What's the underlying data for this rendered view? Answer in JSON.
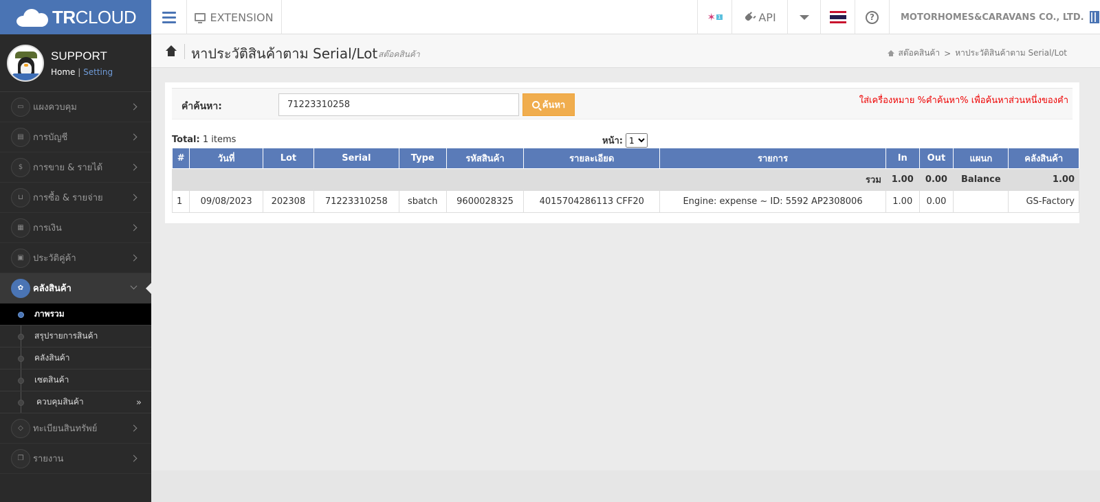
{
  "brand": {
    "bold": "TR",
    "light": "CLOUD"
  },
  "topbar": {
    "extension_label": "EXTENSION",
    "notification_count": "1",
    "api_label": "API",
    "company_name": "MOTORHOMES&CARAVANS CO., LTD.",
    "help_glyph": "?"
  },
  "profile": {
    "name": "SUPPORT",
    "home_link": "Home",
    "separator": "|",
    "setting_link": "Setting"
  },
  "sidebar": {
    "items": [
      {
        "label": "แผงควบคุม",
        "icon": "monitor-icon"
      },
      {
        "label": "การบัญชี",
        "icon": "book-icon"
      },
      {
        "label": "การขาย & รายได้",
        "icon": "dollar-icon"
      },
      {
        "label": "การซื้อ & รายจ่าย",
        "icon": "cart-icon"
      },
      {
        "label": "การเงิน",
        "icon": "calendar-icon"
      },
      {
        "label": "ประวัติคู่ค้า",
        "icon": "contact-icon"
      },
      {
        "label": "คลังสินค้า",
        "icon": "cubes-icon"
      }
    ],
    "submenu": [
      {
        "label": "ภาพรวม"
      },
      {
        "label": "สรุปรายการสินค้า"
      },
      {
        "label": "คลังสินค้า"
      },
      {
        "label": "เซตสินค้า"
      },
      {
        "label": "ควบคุมสินค้า",
        "more": "»"
      }
    ],
    "bottom_items": [
      {
        "label": "ทะเบียนสินทรัพย์",
        "icon": "diamond-icon"
      },
      {
        "label": "รายงาน",
        "icon": "copy-icon"
      }
    ]
  },
  "header": {
    "title": "หาประวัติสินค้าตาม Serial/Lot",
    "subtitle": "สต๊อคสินค้า",
    "breadcrumb": [
      "สต๊อคสินค้า",
      ">",
      "หาประวัติสินค้าตาม Serial/Lot"
    ]
  },
  "search": {
    "label": "คำค้นหา:",
    "value": "71223310258",
    "button_label": "ค้นหา",
    "hint": "ใส่เครื่องหมาย %คำค้นหา% เพื่อค้นหาส่วนหนึ่งของคำ"
  },
  "results": {
    "total_label": "Total:",
    "total_value": "1 items",
    "page_label": "หน้า:",
    "page_value": "1",
    "columns": [
      "#",
      "วันที่",
      "Lot",
      "Serial",
      "Type",
      "รหัสสินค้า",
      "รายละเอียด",
      "รายการ",
      "In",
      "Out",
      "แผนก",
      "คลังสินค้า"
    ],
    "summary": {
      "label": "รวม",
      "in": "1.00",
      "out": "0.00",
      "dept": "Balance",
      "stock": "1.00"
    },
    "rows": [
      [
        "1",
        "09/08/2023",
        "202308",
        "71223310258",
        "sbatch",
        "9600028325",
        "4015704286113 CFF20",
        "Engine: expense ~ ID: 5592 AP2308006",
        "1.00",
        "0.00",
        "",
        "GS-Factory"
      ]
    ]
  },
  "colors": {
    "brand": "#4a74b4",
    "sidebar": "#2a2a2a",
    "table_header": "#5a7bb8",
    "search_button": "#f0ad4e",
    "hint": "#ee0000"
  }
}
